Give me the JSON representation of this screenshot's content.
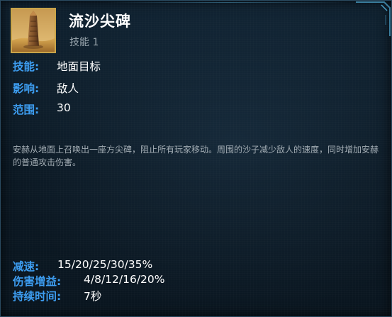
{
  "ability": {
    "name": "流沙尖碑",
    "slot": "技能 1",
    "icon": "obelisk-icon"
  },
  "properties": [
    {
      "label": "技能:",
      "value": "地面目标"
    },
    {
      "label": "影响:",
      "value": "敌人"
    },
    {
      "label": "范围:",
      "value": "30"
    }
  ],
  "description": "安赫从地面上召唤出一座方尖碑，阻止所有玩家移动。周围的沙子减少敌人的速度，同时增加安赫的普通攻击伤害。",
  "stats": [
    {
      "label": "减速:",
      "value": "15/20/25/30/35%"
    },
    {
      "label": "伤害增益:",
      "value": "4/8/12/16/20%"
    },
    {
      "label": "持续时间:",
      "value": "7秒"
    }
  ],
  "colors": {
    "label": "#3d9df0",
    "text": "#ffffff",
    "muted": "#9aa6ae",
    "icon_border": "#c9a449",
    "background": "#0c1a26"
  }
}
